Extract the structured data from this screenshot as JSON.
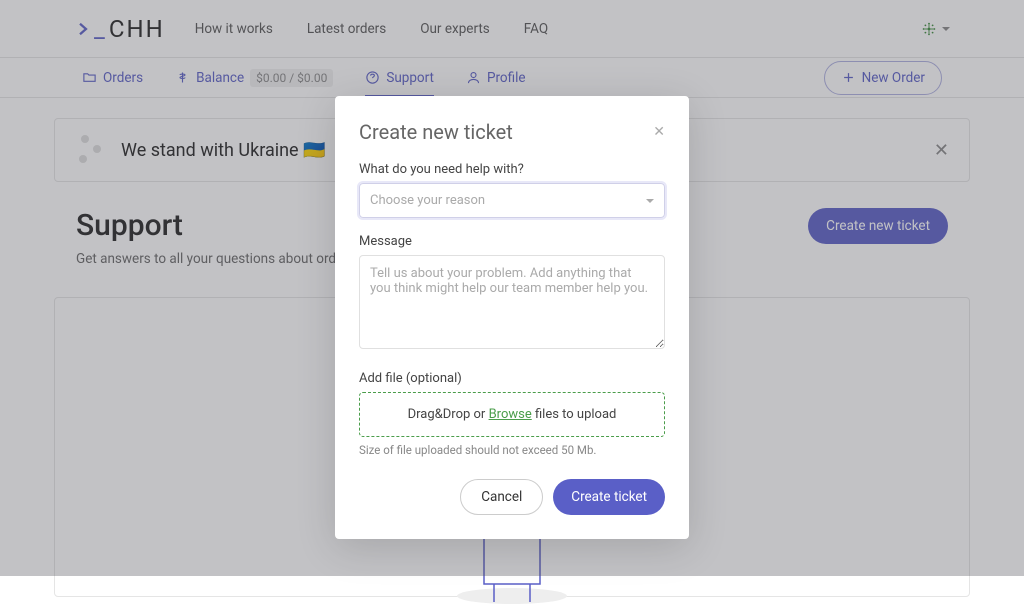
{
  "logo": "CHH",
  "nav": {
    "how": "How it works",
    "latest": "Latest orders",
    "experts": "Our experts",
    "faq": "FAQ"
  },
  "subnav": {
    "orders": "Orders",
    "balance": "Balance",
    "balance_amt": "$0.00 / $0.00",
    "support": "Support",
    "profile": "Profile",
    "neworder": "New Order"
  },
  "banner": {
    "text": "We stand with Ukraine  🇺🇦"
  },
  "page": {
    "title": "Support",
    "subtitle": "Get answers to all your questions about order process",
    "cta": "Create new ticket"
  },
  "modal": {
    "title": "Create new ticket",
    "reason_label": "What do you need help with?",
    "reason_placeholder": "Choose your reason",
    "message_label": "Message",
    "message_placeholder": "Tell us about your problem. Add anything that you think might help our team member help you.",
    "file_label": "Add file (optional)",
    "drop_prefix": "Drag&Drop or ",
    "drop_link": "Browse",
    "drop_suffix": " files to upload",
    "file_hint": "Size of file uploaded should not exceed 50 Mb.",
    "cancel": "Cancel",
    "submit": "Create ticket"
  }
}
